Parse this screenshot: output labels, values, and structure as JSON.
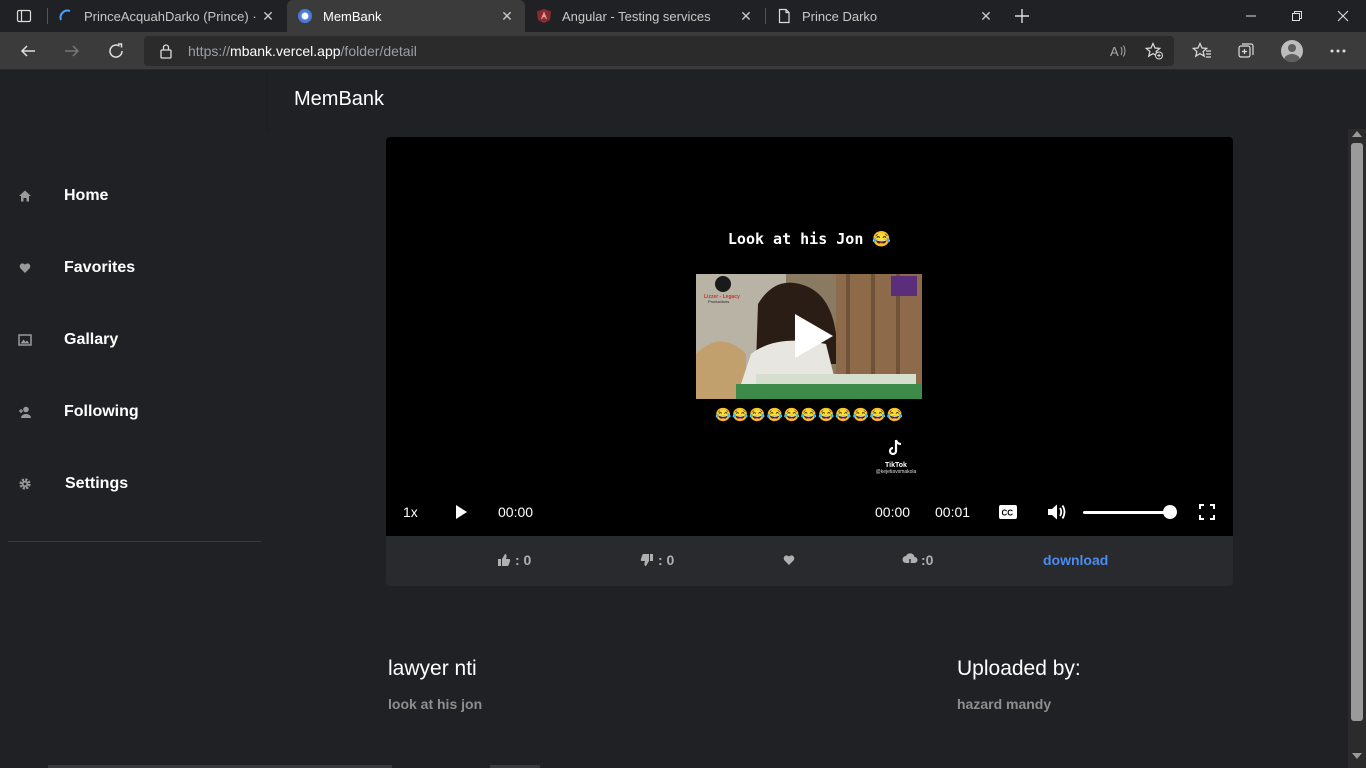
{
  "browser": {
    "tabs": [
      {
        "title": "PrinceAcquahDarko (Prince) · Git",
        "favicon": "github-icon"
      },
      {
        "title": "MemBank",
        "favicon": "membank-icon"
      },
      {
        "title": "Angular - Testing services",
        "favicon": "angular-icon"
      },
      {
        "title": "Prince Darko",
        "favicon": "document-icon"
      }
    ],
    "url_prefix": "https://",
    "url_host": "mbank.vercel.app",
    "url_path": "/folder/detail"
  },
  "app": {
    "brand": "MemBank",
    "nav": [
      {
        "label": "Home",
        "icon": "home-icon"
      },
      {
        "label": "Favorites",
        "icon": "heart-icon"
      },
      {
        "label": "Gallary",
        "icon": "image-icon"
      },
      {
        "label": "Following",
        "icon": "person-add-icon"
      },
      {
        "label": "Settings",
        "icon": "gear-icon"
      }
    ]
  },
  "video": {
    "caption": "Look at his Jon 😂",
    "emoji_row": "😂😂😂😂😂😂😂😂😂😂😂",
    "watermark_logo_text": "Lizzer - Legacy Productions",
    "tiktok_label": "TikTok",
    "tiktok_handle": "@kejetiavsmakola",
    "speed": "1x",
    "current_time": "00:00",
    "time_a": "00:00",
    "time_b": "00:01",
    "volume_level": 0.95
  },
  "actions": {
    "likes": ": 0",
    "dislikes": ": 0",
    "downloads": ":0",
    "download_label": "download"
  },
  "meta": {
    "title": "lawyer nti",
    "description": "look at his jon",
    "uploaded_by_label": "Uploaded by:",
    "uploader": "hazard mandy"
  },
  "colors": {
    "link": "#4a8cf0",
    "background": "#202124",
    "card": "#292a2d"
  }
}
